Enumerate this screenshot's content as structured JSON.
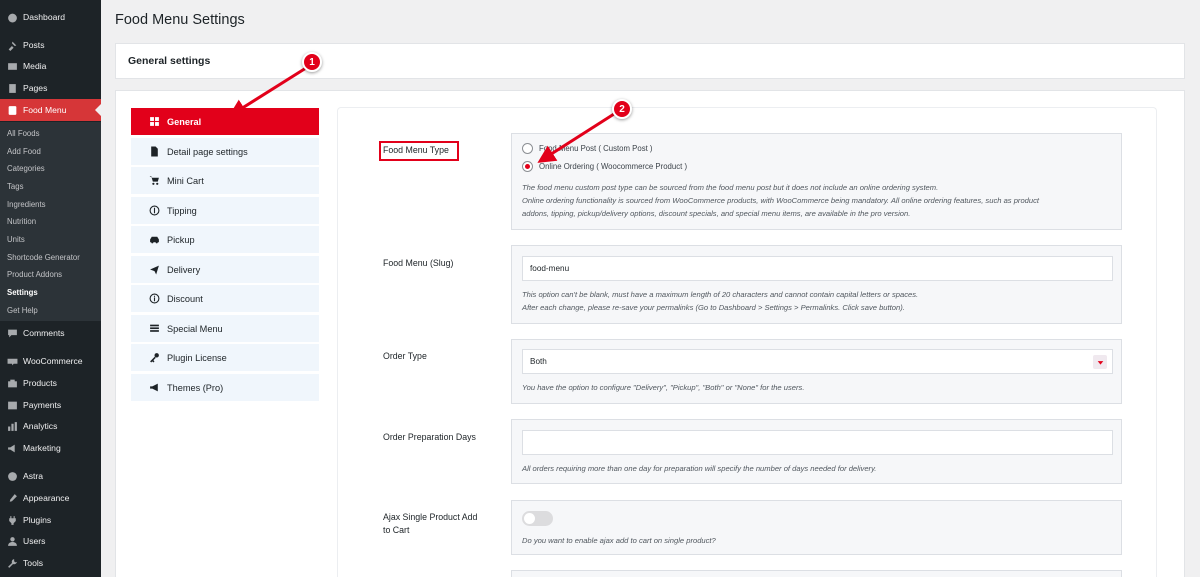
{
  "admin_menu": {
    "items": [
      {
        "label": "Dashboard",
        "icon": "dashboard-icon"
      },
      {
        "label": "Posts",
        "icon": "pin-icon"
      },
      {
        "label": "Media",
        "icon": "media-icon"
      },
      {
        "label": "Pages",
        "icon": "pages-icon"
      },
      {
        "label": "Food Menu",
        "icon": "food-menu-icon"
      },
      {
        "label": "Comments",
        "icon": "comments-icon"
      },
      {
        "label": "WooCommerce",
        "icon": "woocommerce-icon"
      },
      {
        "label": "Products",
        "icon": "products-icon"
      },
      {
        "label": "Payments",
        "icon": "payments-icon"
      },
      {
        "label": "Analytics",
        "icon": "analytics-icon"
      },
      {
        "label": "Marketing",
        "icon": "marketing-icon"
      },
      {
        "label": "Astra",
        "icon": "astra-icon"
      },
      {
        "label": "Appearance",
        "icon": "appearance-icon"
      },
      {
        "label": "Plugins",
        "icon": "plugins-icon"
      },
      {
        "label": "Users",
        "icon": "users-icon"
      },
      {
        "label": "Tools",
        "icon": "tools-icon"
      }
    ],
    "submenu": [
      "All Foods",
      "Add Food",
      "Categories",
      "Tags",
      "Ingredients",
      "Nutrition",
      "Units",
      "Shortcode Generator",
      "Product Addons",
      "Settings",
      "Get Help"
    ]
  },
  "page_title": "Food Menu Settings",
  "general_heading": "General settings",
  "settings_nav": [
    {
      "label": "General",
      "icon": "grid-icon"
    },
    {
      "label": "Detail page settings",
      "icon": "document-icon"
    },
    {
      "label": "Mini Cart",
      "icon": "cart-icon"
    },
    {
      "label": "Tipping",
      "icon": "dollar-icon"
    },
    {
      "label": "Pickup",
      "icon": "car-icon"
    },
    {
      "label": "Delivery",
      "icon": "plane-icon"
    },
    {
      "label": "Discount",
      "icon": "info-icon"
    },
    {
      "label": "Special Menu",
      "icon": "table-icon"
    },
    {
      "label": "Plugin License",
      "icon": "key-icon"
    },
    {
      "label": "Themes (Pro)",
      "icon": "megaphone-icon"
    }
  ],
  "fields": {
    "food_menu_type": {
      "label": "Food Menu Type",
      "option_1": "Food Menu Post ( Custom Post )",
      "option_2": "Online Ordering ( Woocommerce Product )",
      "desc_1": "The food menu custom post type can be sourced from the food menu post but it does not include an online ordering system.",
      "desc_2": "Online ordering functionality is sourced from WooCommerce products, with WooCommerce being mandatory. All online ordering features, such as product",
      "desc_3": "addons, tipping, pickup/delivery options, discount specials, and special menu items, are available in the pro version."
    },
    "slug": {
      "label": "Food Menu (Slug)",
      "value": "food-menu",
      "desc_1": "This option can't be blank, must have a maximum length of 20 characters and cannot contain capital letters or spaces.",
      "desc_2": "After each change, please re-save your permalinks (Go to Dashboard > Settings > Permalinks. Click save button)."
    },
    "order_type": {
      "label": "Order Type",
      "value": "Both",
      "desc": "You have the option to configure \"Delivery\", \"Pickup\", \"Both\" or \"None\" for the users."
    },
    "prep_days": {
      "label": "Order Preparation Days",
      "value": "",
      "desc": "All orders requiring more than one day for preparation will specify the number of days needed for delivery."
    },
    "ajax": {
      "label_1": "Ajax Single Product Add",
      "label_2": "to Cart",
      "desc": "Do you want to enable ajax add to cart on single product?"
    }
  },
  "annotations": [
    "1",
    "2"
  ],
  "colors": {
    "accent": "#e2001a",
    "admin_bg": "#1d2327",
    "wp_red": "#d63638"
  }
}
